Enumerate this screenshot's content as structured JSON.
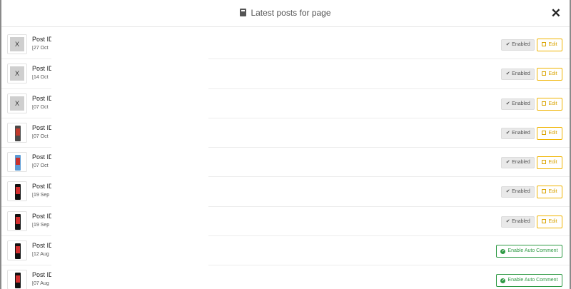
{
  "modal": {
    "title": "Latest posts for page",
    "close_glyph": "✕"
  },
  "posts": [
    {
      "title": "Post ID",
      "date": "[27 Oct ",
      "thumb": "x",
      "action": "enabled"
    },
    {
      "title": "Post ID",
      "date": "[14 Oct ",
      "thumb": "x",
      "action": "enabled"
    },
    {
      "title": "Post ID",
      "date": "[07 Oct ",
      "thumb": "x",
      "action": "enabled"
    },
    {
      "title": "Post ID",
      "date": "[07 Oct ",
      "thumb": "phone-red",
      "action": "enabled"
    },
    {
      "title": "Post ID",
      "date": "[07 Oct ",
      "thumb": "phone-blue",
      "action": "enabled"
    },
    {
      "title": "Post ID",
      "date": "[19 Sep ",
      "thumb": "phone-black",
      "action": "enabled"
    },
    {
      "title": "Post ID",
      "date": "[19 Sep ",
      "thumb": "phone-black",
      "action": "enabled"
    },
    {
      "title": "Post ID",
      "date": "[12 Aug ",
      "thumb": "phone-black",
      "action": "auto"
    },
    {
      "title": "Post ID",
      "date": "[07 Aug ",
      "thumb": "phone-black",
      "action": "auto"
    }
  ],
  "labels": {
    "thumb_x": "X",
    "enabled": "Enabled",
    "edit": "Edit",
    "enable_auto_comment": "Enable Auto Comment"
  },
  "colors": {
    "edit_accent": "#f0b400",
    "auto_green": "#2e9a44",
    "enabled_bg": "#e9e9e9"
  }
}
